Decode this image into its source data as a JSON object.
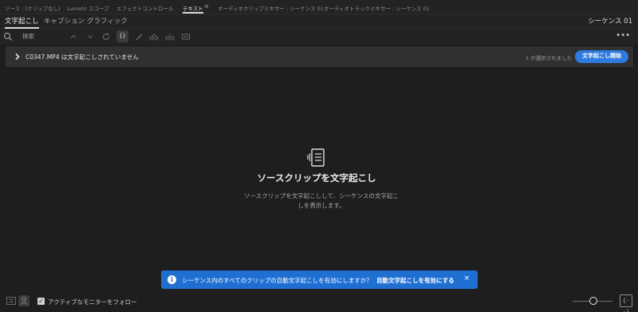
{
  "panel_tabs": [
    {
      "label": "ソース : (クリップなし)",
      "active": false
    },
    {
      "label": "Lumetri スコープ",
      "active": false
    },
    {
      "label": "エフェクトコントロール",
      "active": false
    },
    {
      "label": "テキスト",
      "active": true
    },
    {
      "label": "オーディオクリップミキサー : シーケンス 01",
      "active": false
    },
    {
      "label": "オーディオトラックミキサー : シーケンス 01",
      "active": false
    }
  ],
  "panel_menu_icon": "hamburger-menu-icon",
  "sub_tabs": [
    {
      "label": "文字起こし",
      "active": true
    },
    {
      "label": "キャプション",
      "active": false
    },
    {
      "label": "グラフィック",
      "active": false
    }
  ],
  "sequence_label": "シーケンス 01",
  "toolbar": {
    "search_placeholder": "検索",
    "icons": [
      "search-icon",
      "chevron-up-icon",
      "chevron-down-icon",
      "refresh-icon",
      "braces-icon",
      "pencil-icon",
      "merge-segments-icon",
      "split-segment-icon",
      "export-icon",
      "more-icon"
    ],
    "braces_glyph": "{}",
    "more_glyph": "•••"
  },
  "clip_bar": {
    "clip_name": "C0347.MP4 は文字起こしされていません",
    "status": "1 が選択されました",
    "button_label": "文字起こし開始"
  },
  "empty_state": {
    "icon": "transcript-icon",
    "title": "ソースクリップを文字起こし",
    "description": "ソースクリップを文字起こしして、シーケンスの文字起こしを表示します。"
  },
  "notification": {
    "icon": "info-icon",
    "message": "シーケンス内のすべてのクリップの自動文字起こしを有効にしますか？",
    "action_label": "自動文字起こしを有効にする",
    "close_glyph": "×"
  },
  "footer": {
    "follow_checked": true,
    "follow_label": "アクティブなモニターをフォロー",
    "zoom_fit_glyph": "{--}"
  },
  "colors": {
    "background": "#1e1e1e",
    "accent": "#2d7be0",
    "notification": "#1f6fd3"
  }
}
